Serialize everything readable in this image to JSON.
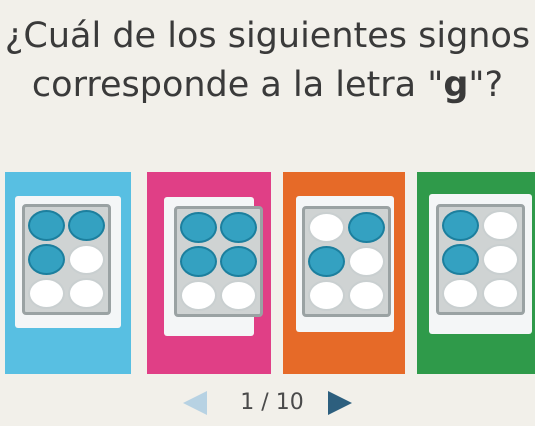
{
  "question": {
    "prefix": "¿Cuál de los siguientes signos corresponde a la letra \"",
    "letter": "g",
    "suffix": "\"?"
  },
  "options": [
    {
      "color": "#58bfe2",
      "dots": [
        true,
        true,
        true,
        false,
        false,
        false
      ],
      "selected": false
    },
    {
      "color": "#e03f86",
      "dots": [
        true,
        true,
        true,
        true,
        false,
        false
      ],
      "selected": false
    },
    {
      "color": "#e66a28",
      "dots": [
        false,
        true,
        true,
        false,
        false,
        false
      ],
      "selected": false
    },
    {
      "color": "#2f9a4a",
      "dots": [
        true,
        false,
        true,
        false,
        false,
        false
      ],
      "selected": false
    }
  ],
  "pager": {
    "current": "1",
    "total": "10",
    "separator": " / ",
    "prev_icon": "triangle-left-icon",
    "next_icon": "triangle-right-icon"
  }
}
